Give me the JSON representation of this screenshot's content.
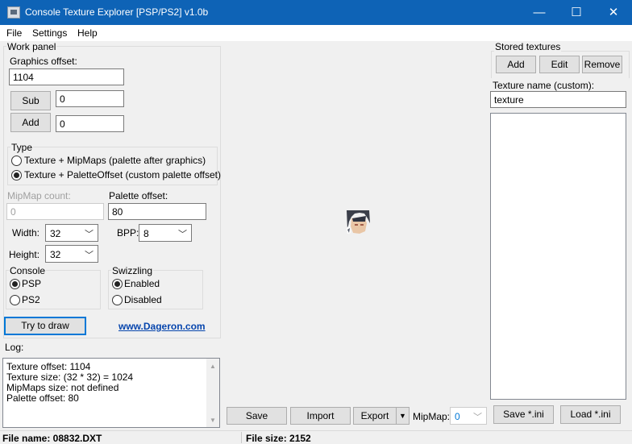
{
  "window": {
    "title": "Console Texture Explorer [PSP/PS2] v1.0b",
    "minimize_glyph": "—",
    "maximize_glyph": "☐",
    "close_glyph": "✕"
  },
  "menu": {
    "file": "File",
    "settings": "Settings",
    "help": "Help"
  },
  "work_panel": {
    "title": "Work panel",
    "graphics_offset_label": "Graphics offset:",
    "graphics_offset_value": "1104",
    "sub_label": "Sub",
    "sub_value": "0",
    "add_label": "Add",
    "add_value": "0",
    "type_title": "Type",
    "type_options": [
      {
        "label": "Texture + MipMaps (palette after graphics)",
        "selected": false
      },
      {
        "label": "Texture + PaletteOffset (custom palette offset)",
        "selected": true
      }
    ],
    "mipmap_count_label": "MipMap count:",
    "mipmap_count_value": "0",
    "palette_offset_label": "Palette offset:",
    "palette_offset_value": "80",
    "width_label": "Width:",
    "width_value": "32",
    "bpp_label": "BPP:",
    "bpp_value": "8",
    "height_label": "Height:",
    "height_value": "32",
    "console_title": "Console",
    "console_options": [
      {
        "label": "PSP",
        "selected": true
      },
      {
        "label": "PS2",
        "selected": false
      }
    ],
    "swizzling_title": "Swizzling",
    "swizzling_options": [
      {
        "label": "Enabled",
        "selected": true
      },
      {
        "label": "Disabled",
        "selected": false
      }
    ],
    "try_button": "Try to draw",
    "website_link": "www.Dageron.com"
  },
  "log": {
    "label": "Log:",
    "lines": [
      "Texture offset: 1104",
      "Texture size: (32 * 32) = 1024",
      "MipMaps size: not defined",
      "Palette offset: 80"
    ]
  },
  "bottom_toolbar": {
    "save": "Save",
    "import": "Import",
    "export": "Export",
    "mipmap_label": "MipMap:",
    "mipmap_value": "0"
  },
  "stored_textures": {
    "title": "Stored textures",
    "add": "Add",
    "edit": "Edit",
    "remove": "Remove",
    "texture_name_label": "Texture name (custom):",
    "texture_name_value": "texture",
    "save_ini": "Save *.ini",
    "load_ini": "Load *.ini"
  },
  "status": {
    "file_name": "File name: 08832.DXT",
    "file_size": "File size: 2152"
  },
  "colors": {
    "titlebar": "#0e63b6",
    "link": "#0645ad",
    "focus_border": "#0078d7"
  }
}
